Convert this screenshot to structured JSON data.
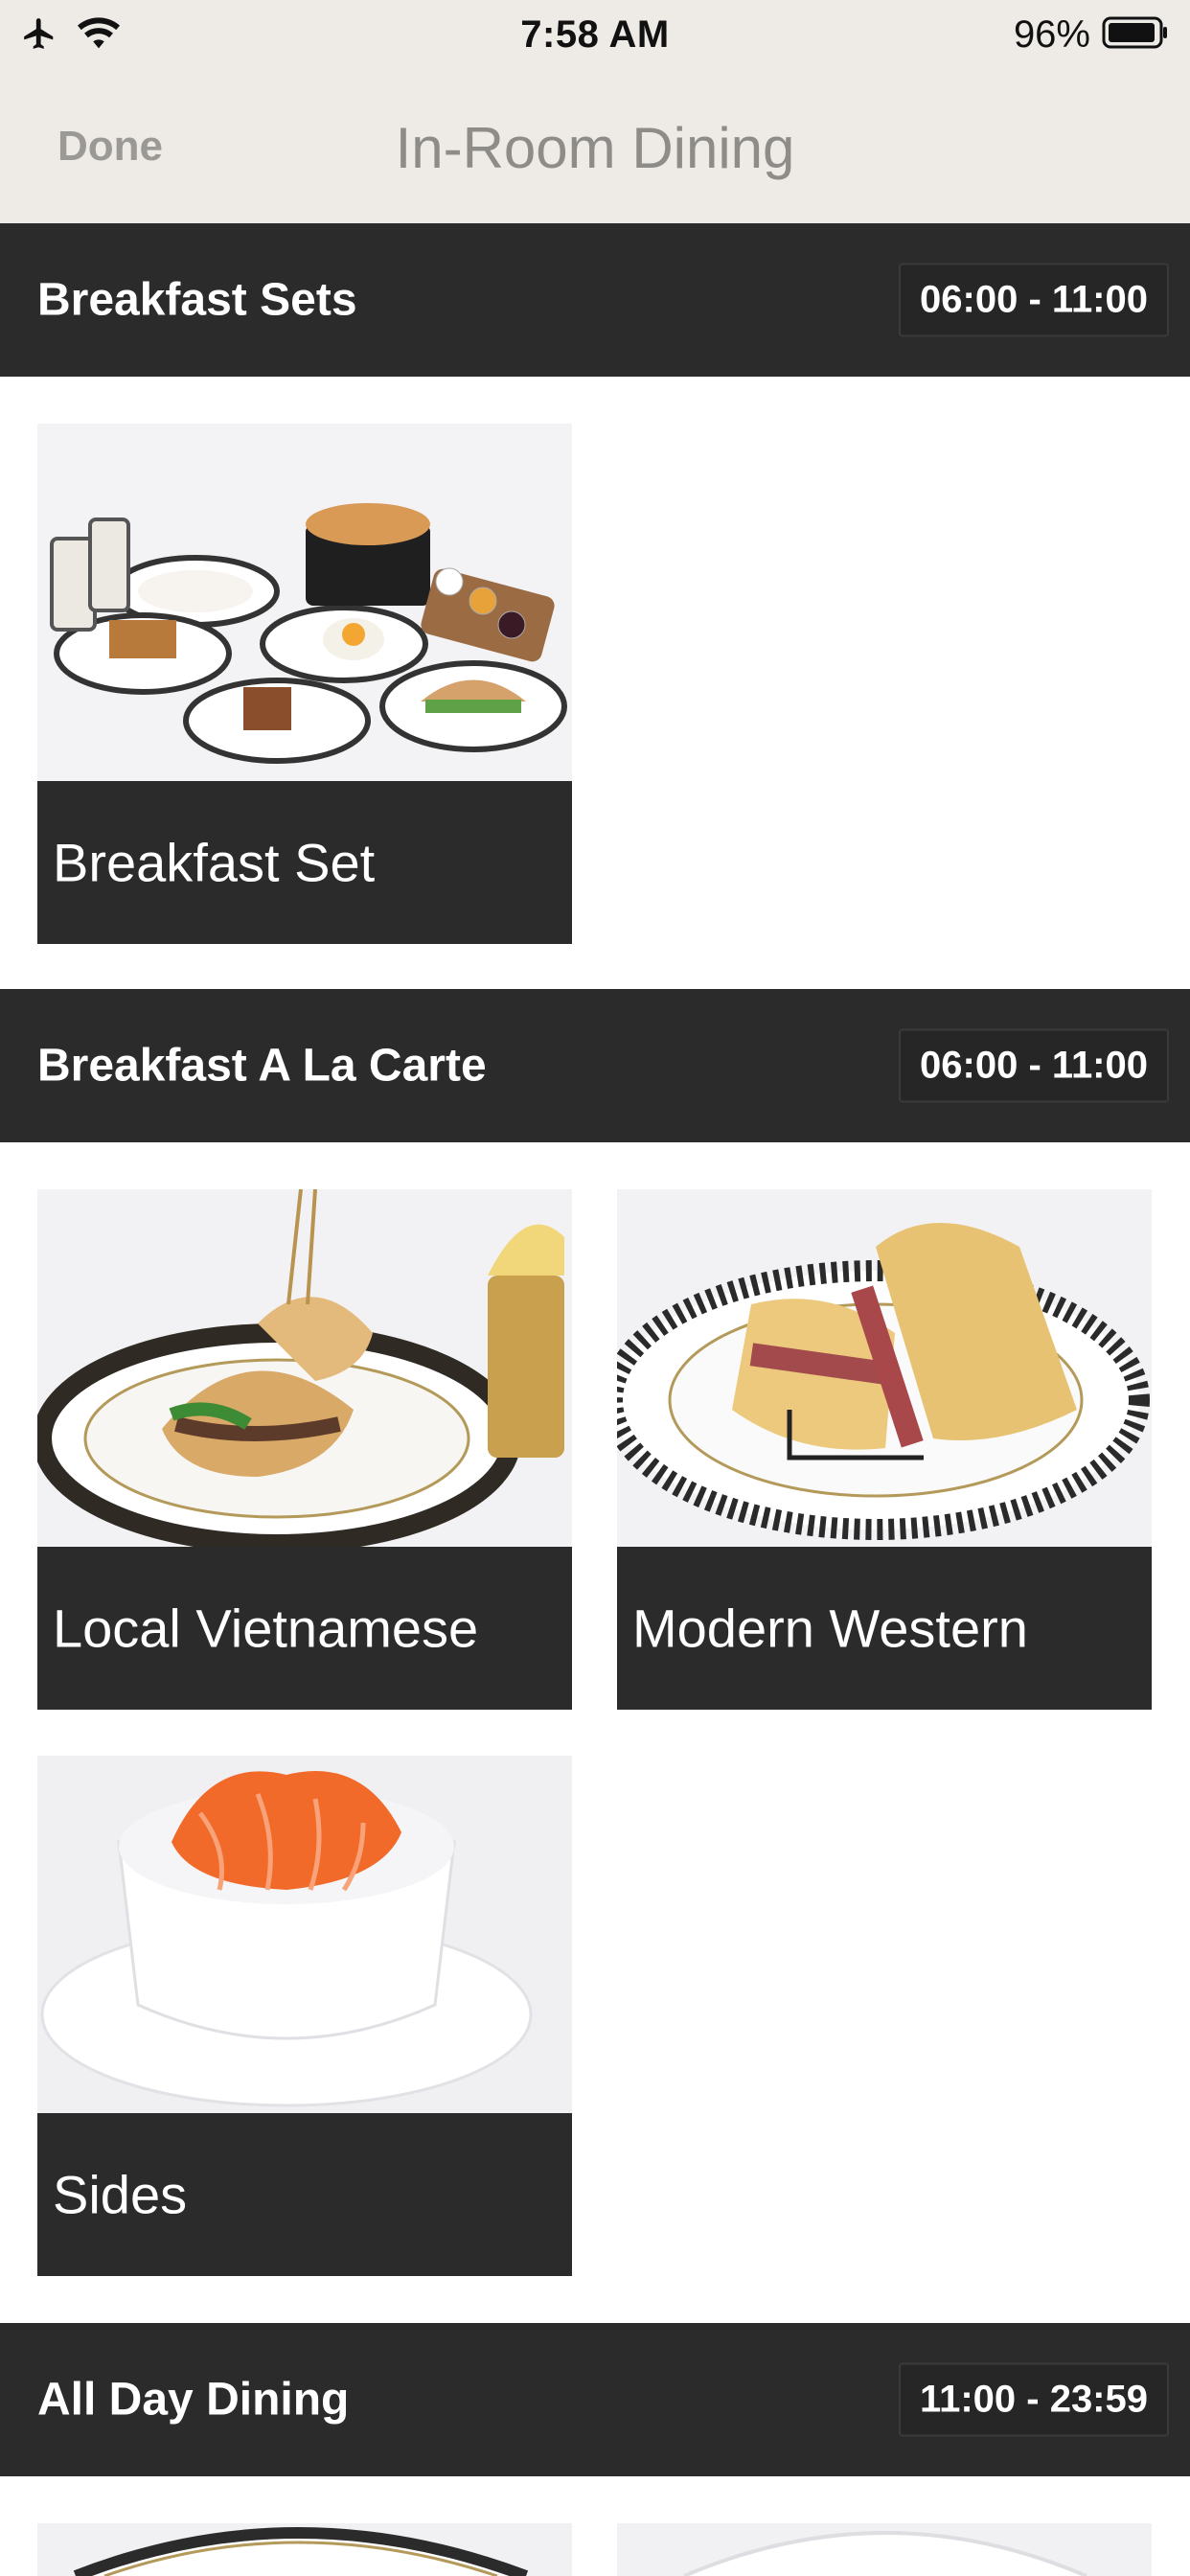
{
  "status_bar": {
    "time": "7:58 AM",
    "battery": "96%"
  },
  "nav": {
    "done_label": "Done",
    "title": "In-Room Dining"
  },
  "sections": [
    {
      "title": "Breakfast Sets",
      "hours": "06:00 - 11:00",
      "items": [
        {
          "label": "Breakfast Set"
        }
      ]
    },
    {
      "title": "Breakfast A La Carte",
      "hours": "06:00 - 11:00",
      "items": [
        {
          "label": "Local Vietnamese"
        },
        {
          "label": "Modern Western"
        },
        {
          "label": "Sides"
        }
      ]
    },
    {
      "title": "All Day Dining",
      "hours": "11:00 - 23:59",
      "items": []
    }
  ],
  "colors": {
    "bar_bg": "#eeeae6",
    "section_bg": "#2b2b2b",
    "caption_text": "#ffffff",
    "nav_text": "#8e8c89"
  }
}
